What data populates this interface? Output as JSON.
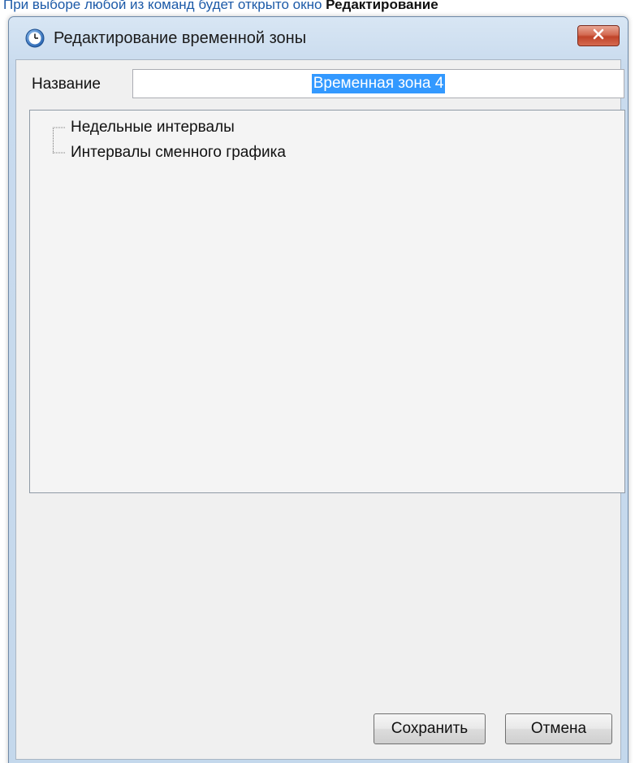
{
  "caption": {
    "text": "При выборе любой из команд будет открыто окно",
    "bold": "Редактирование"
  },
  "window": {
    "title": "Редактирование временной зоны",
    "app_icon": "clock-icon",
    "close_icon": "close-icon"
  },
  "form": {
    "name_label": "Название",
    "name_value": "Временная зона 4"
  },
  "tree": {
    "items": [
      {
        "label": "Недельные интервалы"
      },
      {
        "label": "Интервалы сменного графика"
      }
    ]
  },
  "buttons": {
    "save": "Сохранить",
    "cancel": "Отмена"
  },
  "colors": {
    "selection": "#3399ff",
    "close_button": "#c0442a",
    "caption_link": "#1c5aa8"
  }
}
